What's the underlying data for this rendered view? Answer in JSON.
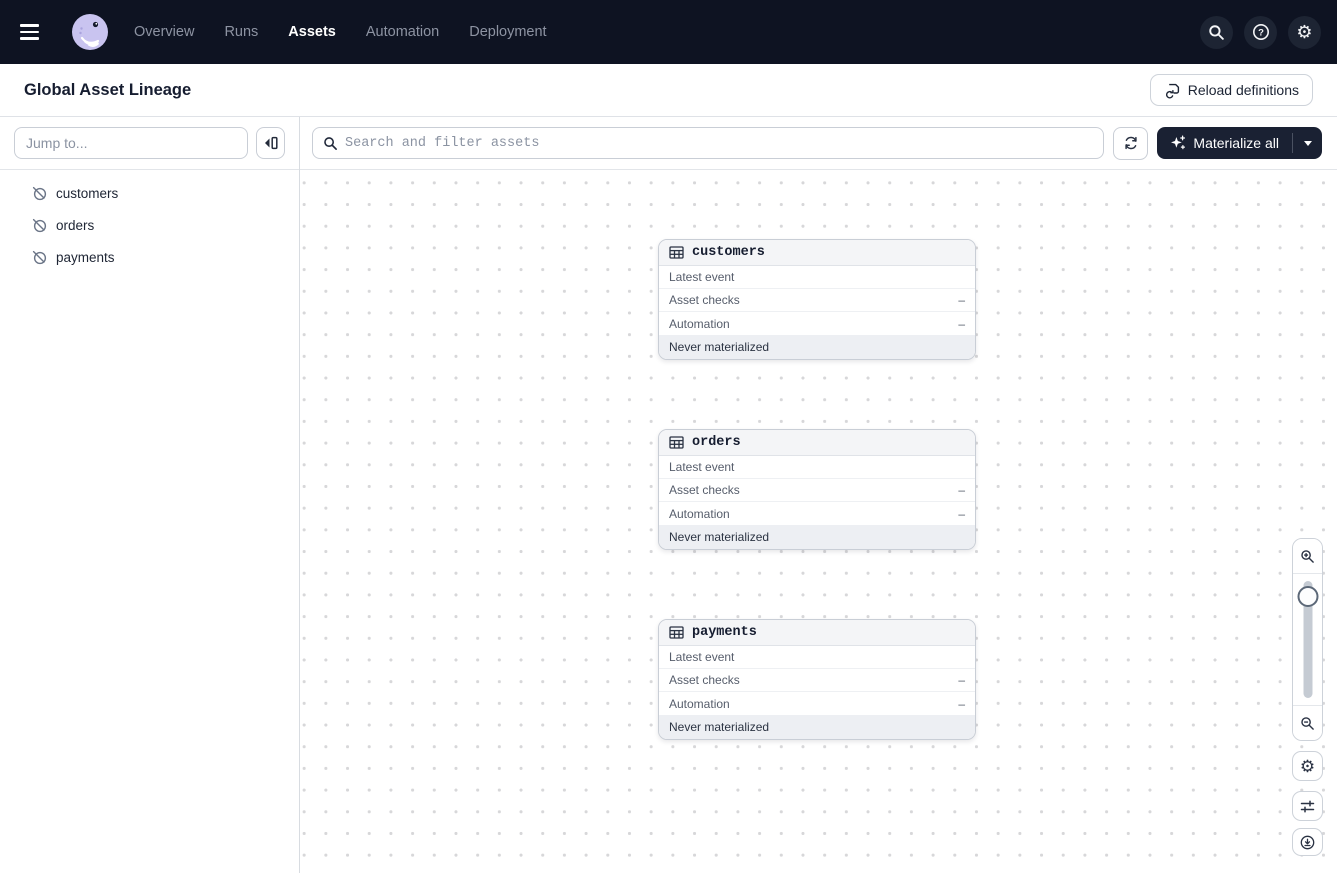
{
  "colors": {
    "topnav_bg": "#0e1322",
    "dark_button_bg": "#1a2133",
    "node_header_bg": "#f4f5f7",
    "node_footer_bg": "#edeff3",
    "canvas_dot": "#d7d7d9",
    "logo_lavender": "#c9c4f0"
  },
  "topnav": {
    "items": [
      {
        "label": "Overview",
        "active": false
      },
      {
        "label": "Runs",
        "active": false
      },
      {
        "label": "Assets",
        "active": true
      },
      {
        "label": "Automation",
        "active": false
      },
      {
        "label": "Deployment",
        "active": false
      }
    ],
    "icons": [
      "search-icon",
      "help-icon",
      "gear-icon"
    ]
  },
  "header": {
    "title": "Global Asset Lineage",
    "reload_label": "Reload definitions"
  },
  "sidebar": {
    "jump_placeholder": "Jump to...",
    "assets": [
      {
        "name": "customers"
      },
      {
        "name": "orders"
      },
      {
        "name": "payments"
      }
    ]
  },
  "toolbar": {
    "search_placeholder": "Search and filter assets",
    "materialize_label": "Materialize all"
  },
  "graph": {
    "row_labels": {
      "latest_event": "Latest event",
      "asset_checks": "Asset checks",
      "automation": "Automation"
    },
    "empty_value": "–",
    "footer_status": "Never materialized",
    "nodes": [
      {
        "name": "customers"
      },
      {
        "name": "orders"
      },
      {
        "name": "payments"
      }
    ]
  }
}
